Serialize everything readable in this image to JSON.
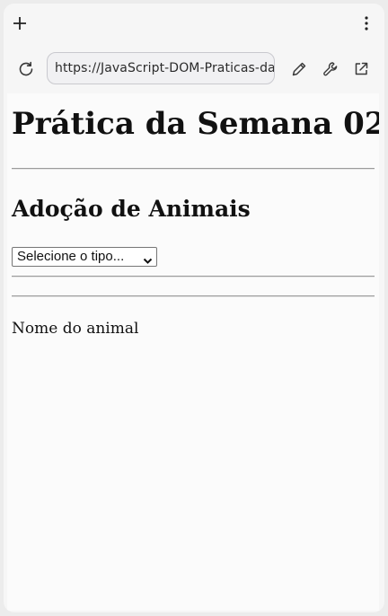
{
  "browser": {
    "url": "https://JavaScript-DOM-Praticas-da",
    "icons": {
      "new_tab": "plus-icon",
      "menu": "kebab-menu-icon",
      "reload": "reload-icon",
      "edit": "pencil-icon",
      "tools": "wrench-icon",
      "open_external": "external-link-icon"
    }
  },
  "page": {
    "title": "Prática da Semana 02",
    "section_title": "Adoção de Animais",
    "select": {
      "selected": "Selecione o tipo..."
    },
    "name_label": "Nome do animal"
  },
  "colors": {
    "background": "#ececec",
    "chrome": "#f6f6f6",
    "page": "#fbfbfb",
    "text": "#111111"
  }
}
